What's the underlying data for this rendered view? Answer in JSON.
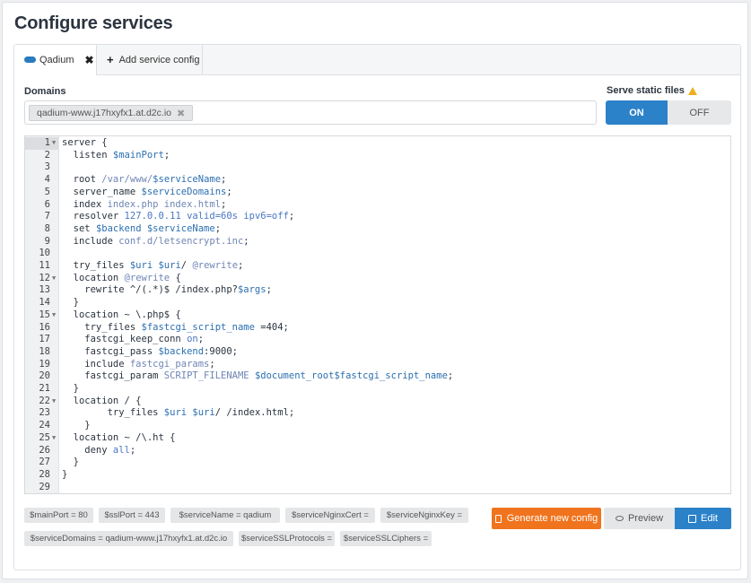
{
  "page": {
    "title": "Configure services"
  },
  "tabs": [
    {
      "label": "Qadium",
      "close": "✖"
    },
    {
      "label": "Add service config",
      "plus": "+"
    }
  ],
  "domains": {
    "label": "Domains",
    "tags": [
      {
        "text": "qadium-www.j17hxyfx1.at.d2c.io",
        "x": "✖"
      }
    ]
  },
  "static_files": {
    "label": "Serve static files",
    "on_label": "ON",
    "off_label": "OFF",
    "selected": "ON",
    "warning_icon": "warning-icon"
  },
  "editor": {
    "current_line": 1,
    "fold_lines": [
      1,
      12,
      15,
      22,
      25
    ],
    "lines": [
      "server {",
      "  listen $mainPort;",
      "",
      "  root /var/www/$serviceName;",
      "  server_name $serviceDomains;",
      "  index index.php index.html;",
      "  resolver 127.0.0.11 valid=60s ipv6=off;",
      "  set $backend $serviceName;",
      "  include conf.d/letsencrypt.inc;",
      "",
      "  try_files $uri $uri/ @rewrite;",
      "  location @rewrite {",
      "    rewrite ^/(.*)$ /index.php?$args;",
      "  }",
      "  location ~ \\.php$ {",
      "    try_files $fastcgi_script_name =404;",
      "    fastcgi_keep_conn on;",
      "    fastcgi_pass $backend:9000;",
      "    include fastcgi_params;",
      "    fastcgi_param SCRIPT_FILENAME $document_root$fastcgi_script_name;",
      "  }",
      "  location / {",
      "        try_files $uri $uri/ /index.html;",
      "    }",
      "  location ~ /\\.ht {",
      "    deny all;",
      "  }",
      "}",
      ""
    ]
  },
  "variables": [
    "$mainPort = 80",
    "$sslPort = 443",
    "$serviceName = qadium",
    "$serviceNginxCert =",
    "$serviceNginxKey =",
    "$serviceDomains = qadium-www.j17hxyfx1.at.d2c.io",
    "$serviceSSLProtocols =",
    "$serviceSSLCiphers ="
  ],
  "actions": {
    "generate_label": "Generate new config",
    "preview_label": "Preview",
    "edit_label": "Edit"
  },
  "colors": {
    "primary": "#2c82c9",
    "accent": "#f0741e",
    "warning": "#f0ad1e"
  }
}
